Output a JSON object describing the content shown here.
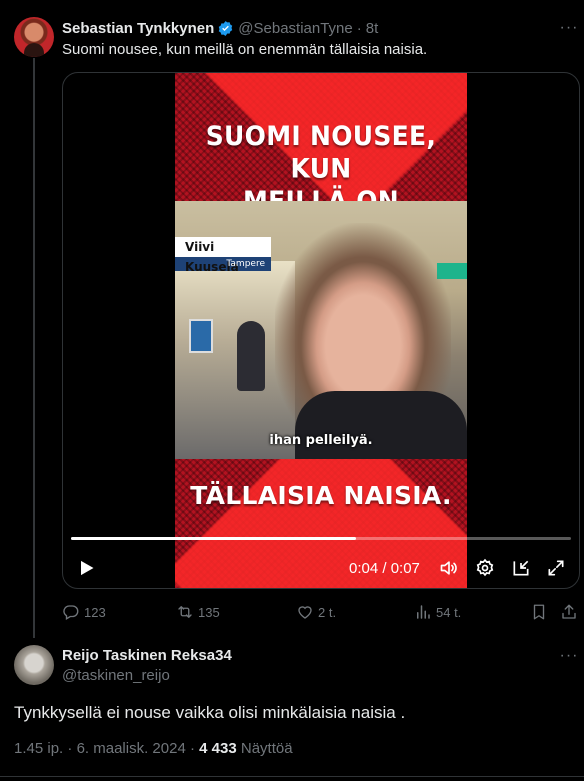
{
  "tweet": {
    "author_name": "Sebastian Tynkkynen",
    "handle": "@SebastianTyne",
    "separator": "·",
    "time": "8t",
    "text": "Suomi nousee, kun meillä on enemmän tällaisia naisia."
  },
  "video": {
    "caption_top_line1": "SUOMI NOUSEE, KUN",
    "caption_top_line2": "MEILLÄ ON ENEMMÄN",
    "caption_bottom": "TÄLLAISIA NAISIA.",
    "lower_third_name": "Viivi Kuusela",
    "lower_third_place": "Tampere",
    "subtitle": "ihan pelleilyä.",
    "time_display": "0:04 / 0:07",
    "progress": 0.57,
    "controls": [
      "play-icon",
      "volume-icon",
      "settings-icon",
      "pip-icon",
      "fullscreen-icon"
    ]
  },
  "actions": {
    "replies": "123",
    "reposts": "135",
    "likes": "2 t.",
    "views": "54 t."
  },
  "reply": {
    "author_name": "Reijo Taskinen Reksa34",
    "handle": "@taskinen_reijo",
    "text": "Tynkkysellä ei nouse vaikka olisi minkälaisia naisia .",
    "time": "1.45 ip.",
    "separator": "·",
    "date": "6. maalisk. 2024",
    "views_count": "4 433",
    "views_label": "Näyttöä"
  },
  "colors": {
    "background": "#000000",
    "text": "#e7e9ea",
    "muted": "#71767b",
    "verified": "#1d9bf0",
    "poster_red": "#b31220"
  }
}
